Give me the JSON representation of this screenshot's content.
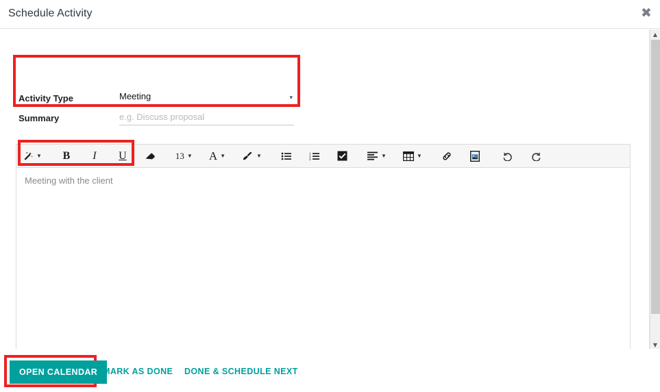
{
  "dialog": {
    "title": "Schedule Activity",
    "close_icon": "close-icon",
    "close_glyph": "✖"
  },
  "form": {
    "activity_type": {
      "label": "Activity Type",
      "value": "Meeting",
      "caret": "▾"
    },
    "summary": {
      "label": "Summary",
      "value": "",
      "placeholder": "e.g. Discuss proposal"
    }
  },
  "editor": {
    "note_text": "Meeting with the client",
    "toolbar": [
      {
        "name": "style-wand-icon",
        "label": "",
        "caret": true
      },
      {
        "name": "bold-icon",
        "label": "B",
        "caret": false
      },
      {
        "name": "italic-icon",
        "label": "I",
        "caret": false
      },
      {
        "name": "underline-icon",
        "label": "U",
        "caret": false
      },
      {
        "name": "eraser-icon",
        "label": "",
        "caret": false
      },
      {
        "name": "font-size-selector",
        "label": "13",
        "caret": true
      },
      {
        "name": "font-color-icon",
        "label": "A",
        "caret": true
      },
      {
        "name": "background-color-icon",
        "label": "",
        "caret": true
      },
      {
        "name": "unordered-list-icon",
        "label": "",
        "caret": false
      },
      {
        "name": "ordered-list-icon",
        "label": "",
        "caret": false
      },
      {
        "name": "checklist-icon",
        "label": "",
        "caret": false
      },
      {
        "name": "align-icon",
        "label": "",
        "caret": true
      },
      {
        "name": "table-icon",
        "label": "",
        "caret": true
      },
      {
        "name": "link-icon",
        "label": "",
        "caret": false
      },
      {
        "name": "image-icon",
        "label": "",
        "caret": false
      },
      {
        "name": "undo-icon",
        "label": "",
        "caret": false
      },
      {
        "name": "redo-icon",
        "label": "",
        "caret": false
      }
    ]
  },
  "footer": {
    "open_calendar": "OPEN CALENDAR",
    "mark_as_done": "MARK AS DONE",
    "done_schedule_next": "DONE & SCHEDULE NEXT"
  },
  "scrollbar": {
    "up_glyph": "▲",
    "down_glyph": "▼"
  },
  "colors": {
    "accent_teal": "#00a09d",
    "highlight_red": "#ee2021",
    "toolbar_bg": "#f6f6f6",
    "border": "#dcdcdc"
  }
}
